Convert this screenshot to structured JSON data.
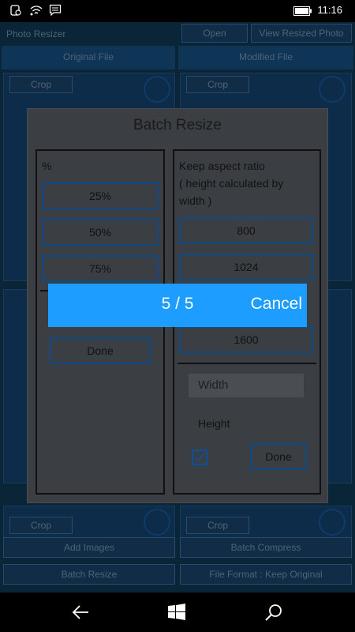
{
  "status": {
    "time": "11:16"
  },
  "background": {
    "app_title": "Photo Resizer",
    "open_label": "Open",
    "view_label": "View Resized Photo",
    "tab_original": "Original File",
    "tab_modified": "Modified File",
    "crop_label": "Crop",
    "add_images": "Add Images",
    "batch_compress": "Batch Compress",
    "batch_resize": "Batch Resize",
    "file_format": "File Format : Keep Original"
  },
  "dialog": {
    "title": "Batch Resize",
    "percent_header": "%",
    "percent_options": [
      "25%",
      "50%",
      "75%"
    ],
    "done_label": "Done",
    "keep_aspect_text_line1": "Keep aspect ratio",
    "keep_aspect_text_line2": "( height calculated by",
    "keep_aspect_text_line3": "width )",
    "width_options": [
      "800",
      "1024",
      "1600"
    ],
    "width_placeholder": "Width",
    "height_label": "Height",
    "done_right_label": "Done"
  },
  "progress": {
    "count": "5 / 5",
    "cancel_label": "Cancel"
  },
  "icons": {
    "back": "back-arrow-icon",
    "start": "windows-start-icon",
    "search": "search-icon"
  },
  "colors": {
    "accent": "#1c9dff",
    "modal_bg": "#3b3f44",
    "button_border": "#0c4a8a"
  }
}
